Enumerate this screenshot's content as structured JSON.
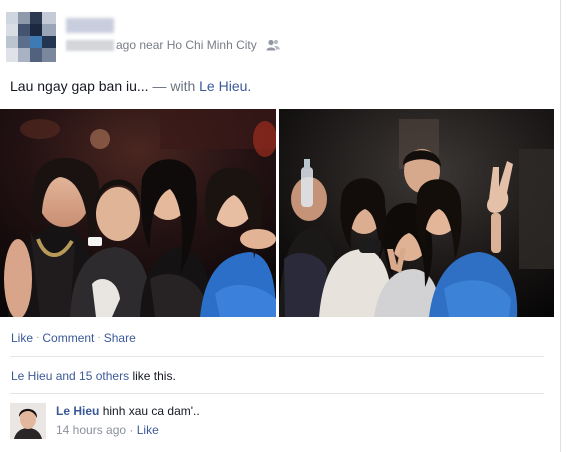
{
  "post": {
    "time_suffix": "ago near",
    "location": "Ho Chi Minh City",
    "privacy_icon": "friends-icon",
    "message": "Lau ngay gap ban iu...",
    "with_prefix": "— with",
    "tagged": "Le Hieu."
  },
  "photos": [
    {
      "name": "group-photo-left"
    },
    {
      "name": "group-photo-right"
    }
  ],
  "actions": {
    "like": "Like",
    "comment": "Comment",
    "share": "Share",
    "dot": "·"
  },
  "likes_summary": {
    "names": "Le Hieu and 15 others",
    "suffix": "like this."
  },
  "comment": {
    "author": "Le Hieu",
    "text": "hinh xau ca dam'..",
    "time": "14 hours ago",
    "dot": "·",
    "like": "Like"
  },
  "colors": {
    "link": "#3b5998",
    "meta": "#777d86",
    "text": "#141823"
  }
}
